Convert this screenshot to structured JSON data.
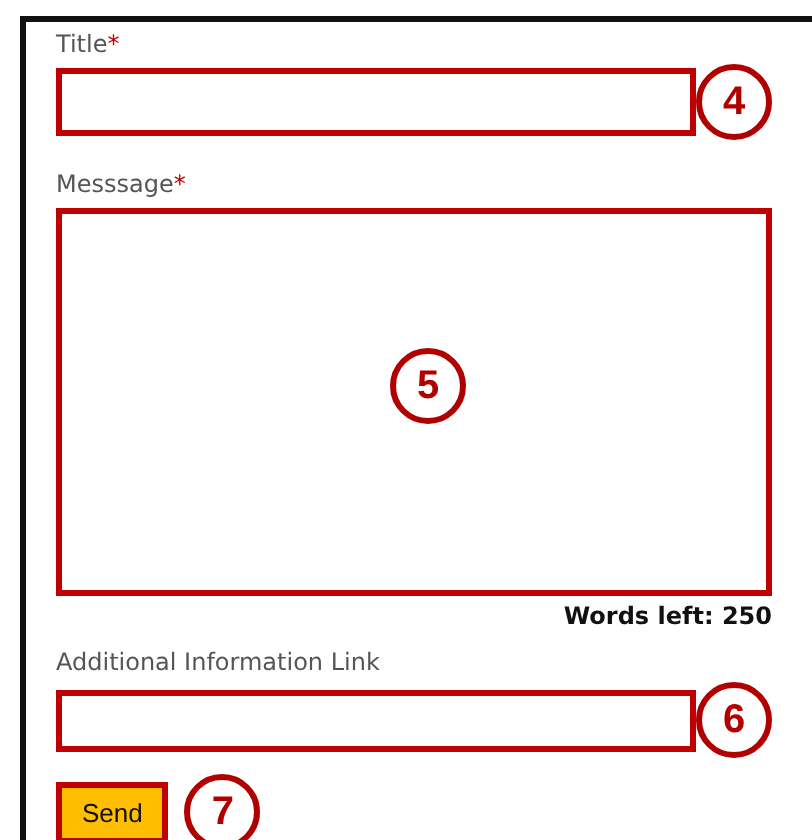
{
  "form": {
    "fields": [
      {
        "kind": "input",
        "label": "Title",
        "required_mark": "*",
        "callout": "4"
      },
      {
        "kind": "textarea",
        "label": "Messsage",
        "required_mark": "*",
        "callout": "5",
        "counter": "Words left: 250"
      },
      {
        "kind": "input",
        "label": "Additional Information Link",
        "callout": "6"
      }
    ],
    "send_button": {
      "label": "Send",
      "callout": "7"
    }
  }
}
